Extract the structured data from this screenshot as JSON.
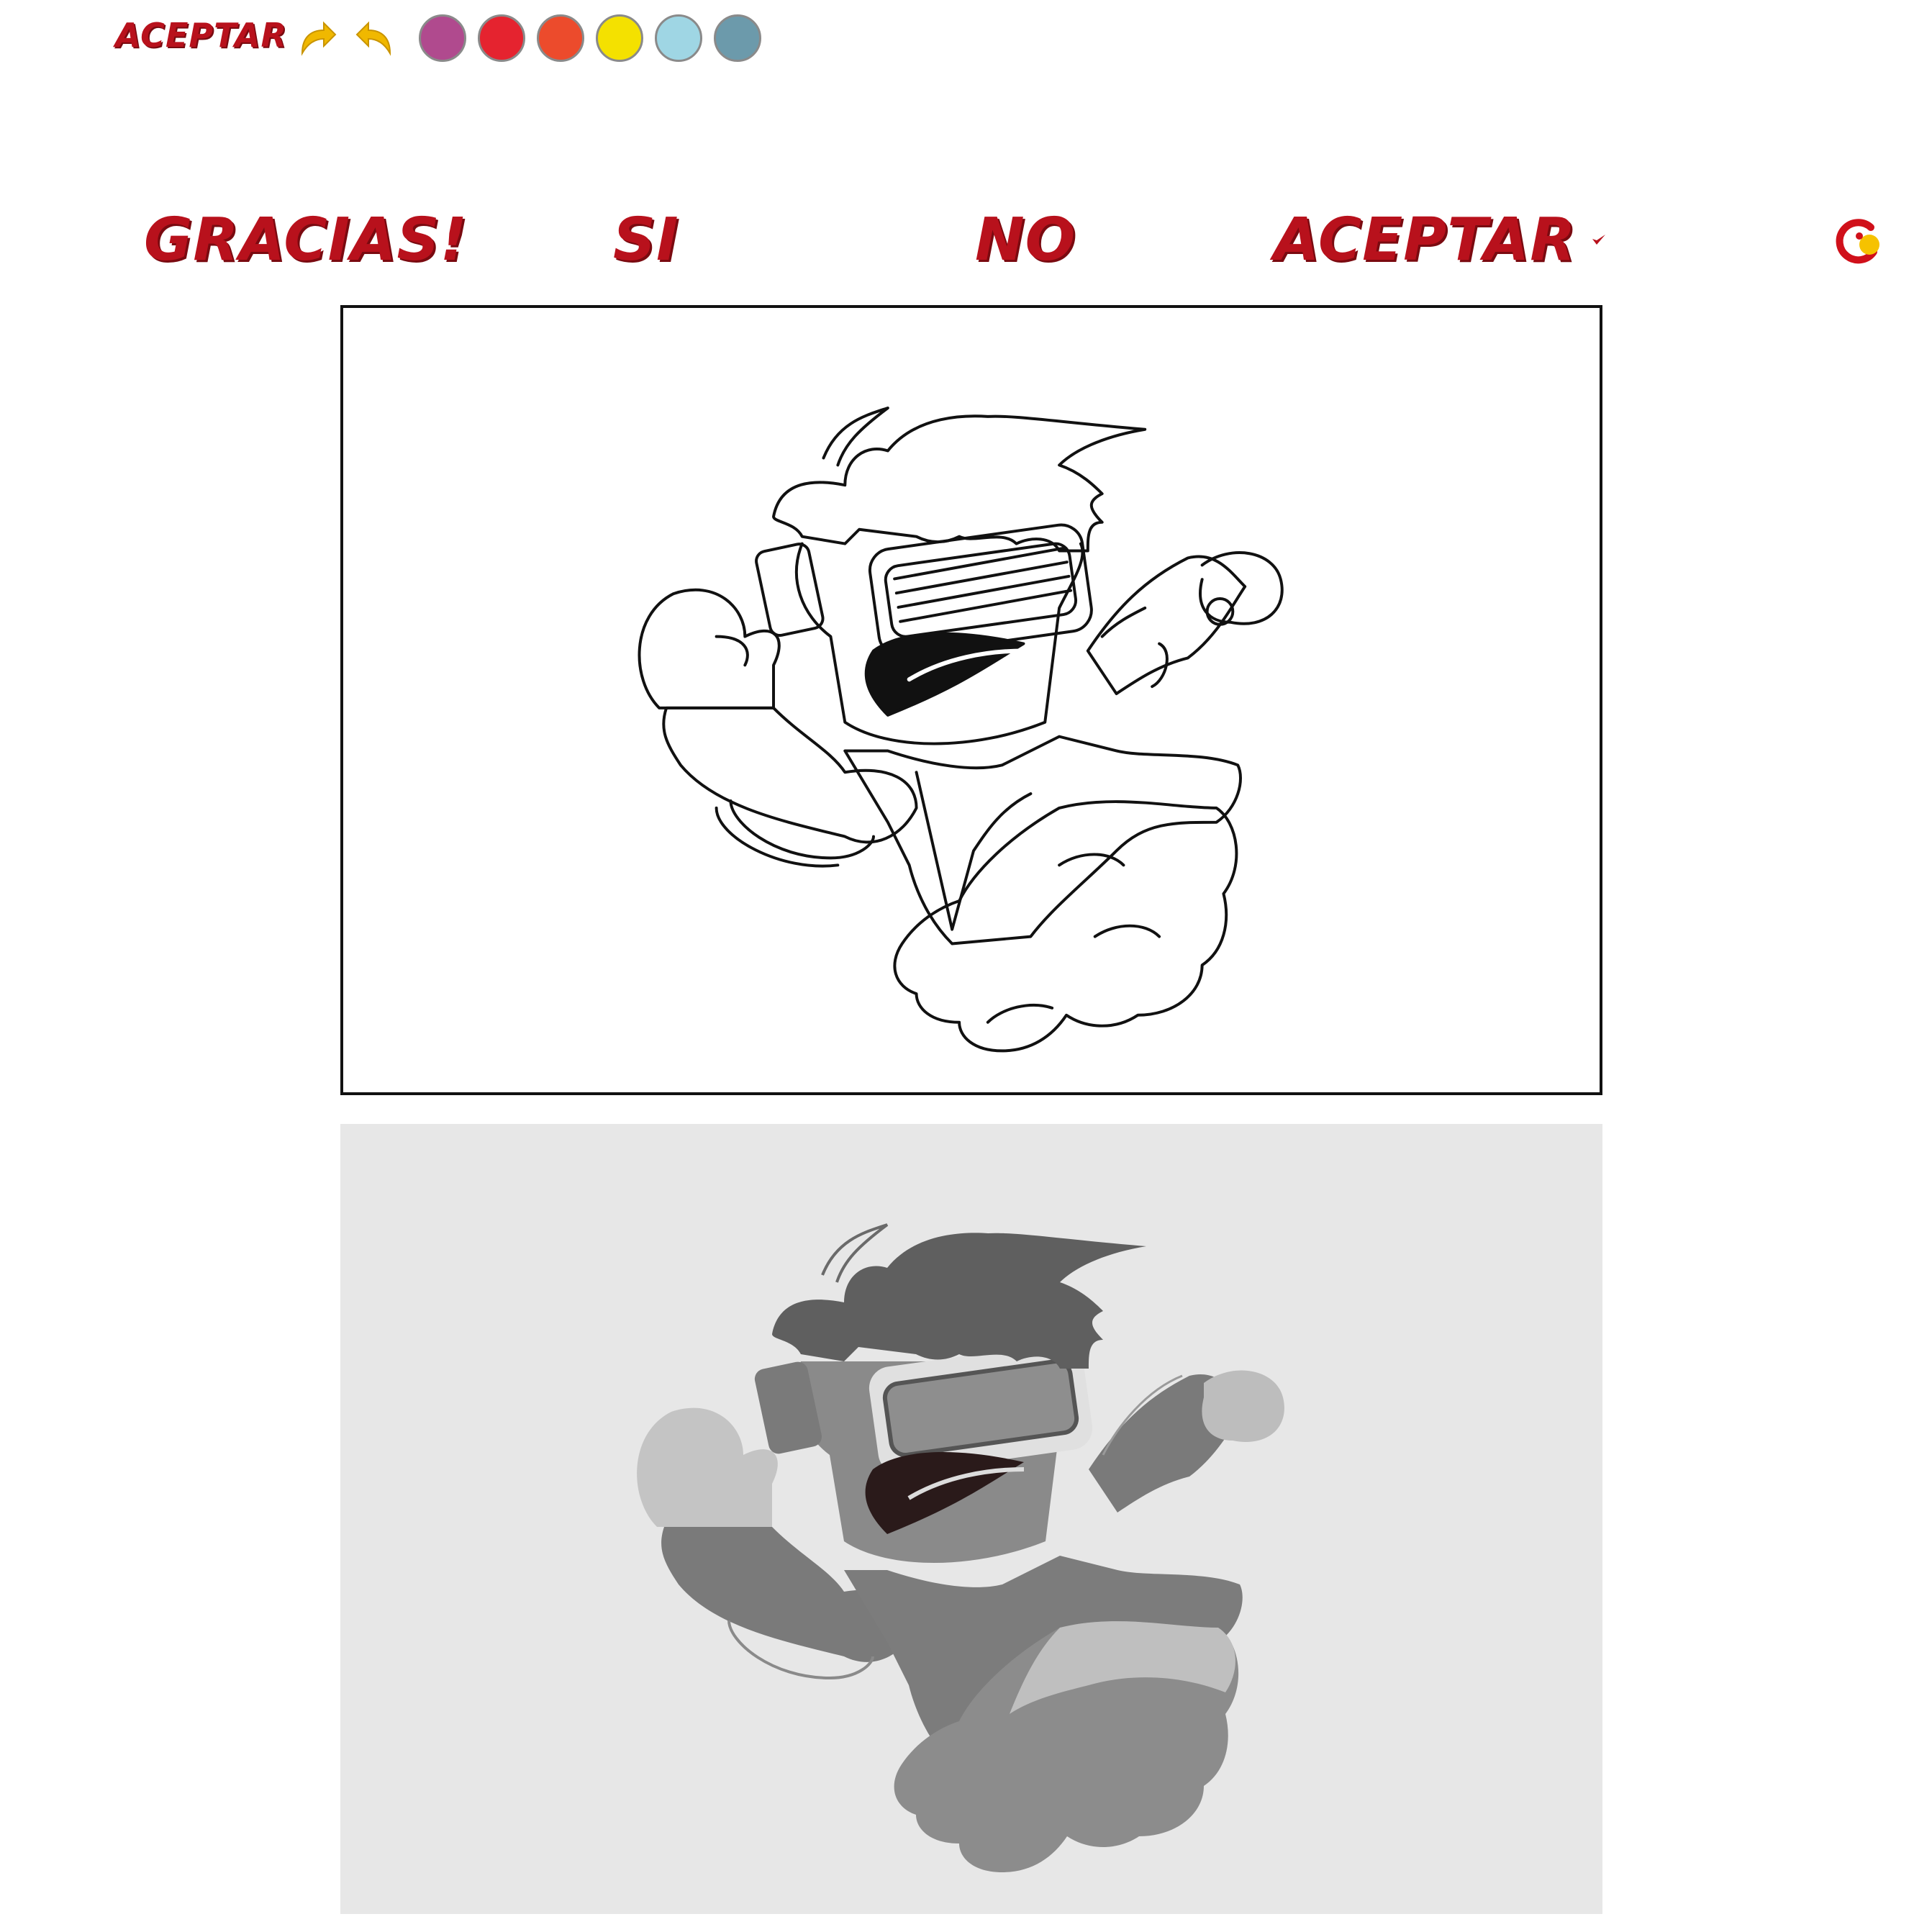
{
  "toolbar": {
    "accept_label": "ACEPTAR",
    "redo_icon": "redo-arrow-icon",
    "undo_icon": "undo-arrow-icon",
    "arrow_color": "#f0b800",
    "swatches": [
      {
        "name": "purple",
        "color": "#b04a8e"
      },
      {
        "name": "red",
        "color": "#e5232f"
      },
      {
        "name": "orange",
        "color": "#ec4b2c"
      },
      {
        "name": "yellow",
        "color": "#f4e100"
      },
      {
        "name": "light-blue",
        "color": "#9fd6e4"
      },
      {
        "name": "steel-blue",
        "color": "#6c9aab"
      }
    ]
  },
  "options": {
    "thanks_label": "GRACIAS!",
    "yes_label": "SI",
    "no_label": "NO",
    "accept_label": "ACEPTAR"
  },
  "brand": {
    "text_color": "#b8111c",
    "logo_icon": "game-logo-icon"
  }
}
